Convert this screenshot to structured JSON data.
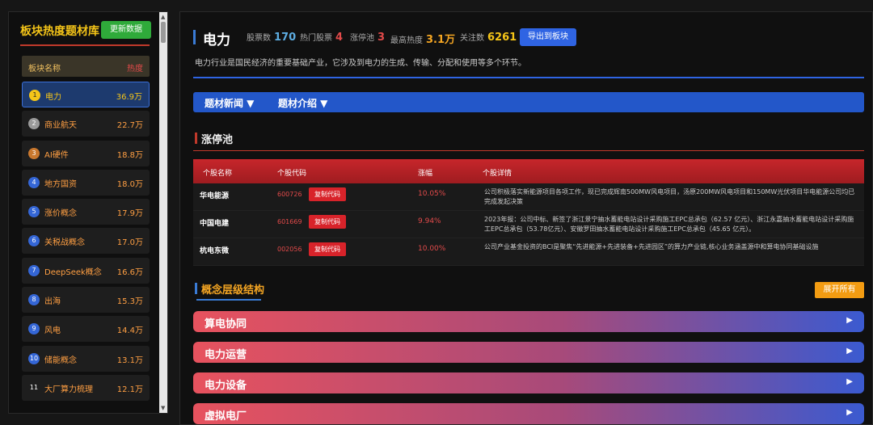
{
  "sidebar": {
    "title": "板块热度题材库",
    "update_label": "更新数据",
    "col_name": "板块名称",
    "col_heat": "热度",
    "items": [
      {
        "num": "1",
        "name": "电力",
        "heat": "36.9万",
        "color": "#f5c518"
      },
      {
        "num": "2",
        "name": "商业航天",
        "heat": "22.7万",
        "color": "#9a9a9a"
      },
      {
        "num": "3",
        "name": "AI硬件",
        "heat": "18.8万",
        "color": "#c9782e"
      },
      {
        "num": "4",
        "name": "地方国资",
        "heat": "18.0万",
        "color": "#3466d6"
      },
      {
        "num": "5",
        "name": "涨价概念",
        "heat": "17.9万",
        "color": "#3466d6"
      },
      {
        "num": "6",
        "name": "关税战概念",
        "heat": "17.0万",
        "color": "#3466d6"
      },
      {
        "num": "7",
        "name": "DeepSeek概念",
        "heat": "16.6万",
        "color": "#3466d6"
      },
      {
        "num": "8",
        "name": "出海",
        "heat": "15.3万",
        "color": "#3466d6"
      },
      {
        "num": "9",
        "name": "风电",
        "heat": "14.4万",
        "color": "#3466d6"
      },
      {
        "num": "10",
        "name": "储能概念",
        "heat": "13.1万",
        "color": "#3466d6"
      },
      {
        "num": "11",
        "name": "大厂算力梳理",
        "heat": "12.1万",
        "color": "#1e1e1e"
      }
    ]
  },
  "header": {
    "title": "电力",
    "stocks_label": "股票数",
    "stocks_value": "170",
    "hot_label": "热门股票",
    "hot_value": "4",
    "limit_label": "涨停池",
    "limit_value": "3",
    "max_heat_label": "最高热度",
    "max_heat_value": "3.1万",
    "follow_label": "关注数",
    "follow_value": "6261",
    "export_label": "导出到板块",
    "description": "电力行业是国民经济的重要基础产业，它涉及到电力的生成、传输、分配和使用等多个环节。"
  },
  "tabs": [
    "题材新闻 ▼",
    "题材介绍 ▼"
  ],
  "limit_pool": {
    "title": "涨停池",
    "headers": [
      "个股名称",
      "个股代码",
      "涨幅",
      "个股详情"
    ],
    "copy_label": "复制代码",
    "rows": [
      {
        "name": "华电能源",
        "code": "600726",
        "change": "10.05%",
        "detail": "公司积极落实新能源项目各项工作，现已完成辉南500MW风电项目，汤原200MW风电项目和150MW光伏项目华电能源公司均已完成发起决策"
      },
      {
        "name": "中国电建",
        "code": "601669",
        "change": "9.94%",
        "detail": "2023年报：公司中标、新签了浙江景宁抽水蓄能电站设计采购施工EPC总承包（62.57 亿元）、浙江永嘉抽水蓄能电站设计采购施工EPC总承包（53.78亿元）、安徽罗田抽水蓄能电站设计采购施工EPC总承包（45.65 亿元）。"
      },
      {
        "name": "杭电东微",
        "code": "002056",
        "change": "10.00%",
        "detail": "公司产业基金投资的BCI是聚焦“先进能源+先进装备+先进园区”的算力产业链,核心业务涵盖源中和算电协同基础设施"
      }
    ]
  },
  "concept": {
    "title": "概念层级结构",
    "expand_label": "展开所有",
    "items": [
      "算电协同",
      "电力运营",
      "电力设备",
      "虚拟电厂"
    ]
  }
}
